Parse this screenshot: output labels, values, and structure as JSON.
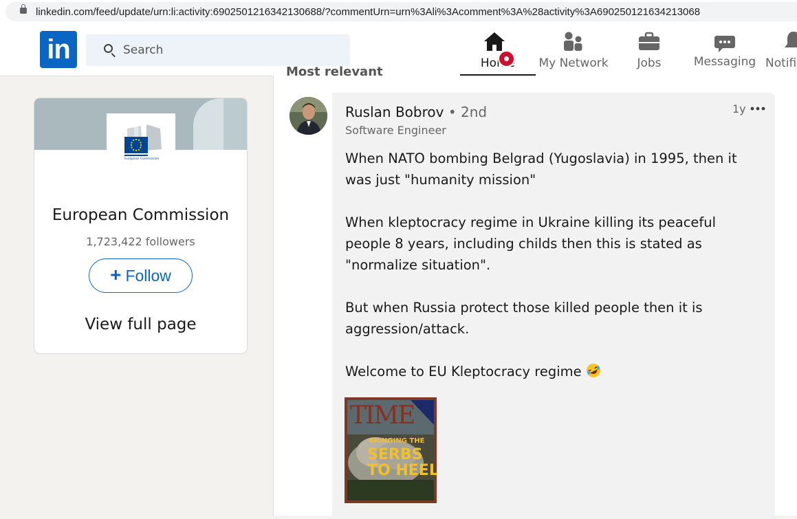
{
  "browser": {
    "url": "linkedin.com/feed/update/urn:li:activity:6902501216342130688/?commentUrn=urn%3Ali%3Acomment%3A%28activity%3A690250121634213068"
  },
  "header": {
    "logo_text": "in",
    "search_placeholder": "Search",
    "nav": [
      {
        "label": "Home",
        "icon": "home-icon",
        "active": true
      },
      {
        "label": "My Network",
        "icon": "network-icon"
      },
      {
        "label": "Jobs",
        "icon": "briefcase-icon"
      },
      {
        "label": "Messaging",
        "icon": "message-icon"
      },
      {
        "label": "Notifi",
        "icon": "bell-icon"
      }
    ]
  },
  "org_card": {
    "logo_caption": "European Commission",
    "name": "European Commission",
    "followers": "1,723,422 followers",
    "follow_label": "Follow",
    "follow_icon": "+",
    "view_full_label": "View full page"
  },
  "feed": {
    "sort_label": "Most relevant"
  },
  "comment": {
    "author": "Ruslan Bobrov",
    "degree": "• 2nd",
    "headline": "Software Engineer",
    "time": "1y",
    "paragraphs": [
      "When NATO bombing Belgrad (Yugoslavia) in 1995, then it was just \"humanity mission\"",
      "When kleptocracy regime in Ukraine killing its peaceful people 8 years, including childs then this is stated as \"normalize situation\".",
      "But when Russia protect those killed people then it is aggression/attack.",
      "Welcome to EU Kleptocracy regime"
    ],
    "image": {
      "masthead": "TIME",
      "cover_headline_1": "BRINGING THE",
      "cover_headline_2": "SERBS",
      "cover_headline_3": "TO HEEL"
    }
  },
  "colors": {
    "brand": "#0a66c2",
    "notification_badge": "#cb112d",
    "bubble": "#f2f2f2"
  }
}
